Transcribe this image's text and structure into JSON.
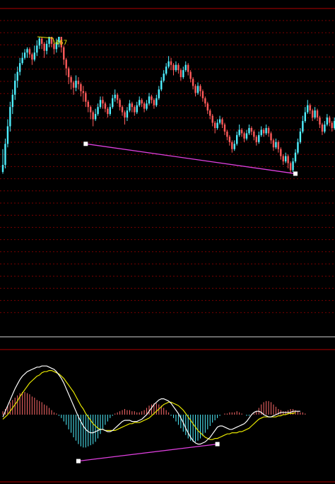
{
  "colors": {
    "background": "#000000",
    "grid": "#7a0000",
    "separator_red": "#b00000",
    "separator_gray": "#8c8c8c",
    "candle_up": "#ff5a5a",
    "candle_down": "#4ff0ff",
    "divergence_line": "#e040e0",
    "peak_marker": "#e6e600",
    "dif_line": "#ffffff",
    "dea_line": "#e6e600",
    "hist_positive": "#ff6a6a",
    "hist_negative": "#4ff0ff",
    "marker": "#ffffff"
  },
  "price_panel": {
    "peak_label": "467"
  },
  "chart_data": [
    {
      "type": "candlestick",
      "title": "",
      "ylim": [
        0,
        100
      ],
      "grid": true,
      "grid_style": "dotted horizontal",
      "candles": [
        [
          27,
          36,
          22,
          23
        ],
        [
          39,
          42,
          25,
          27
        ],
        [
          49,
          53,
          37,
          39
        ],
        [
          60,
          63,
          46,
          49
        ],
        [
          67,
          70,
          56,
          60
        ],
        [
          75,
          79,
          64,
          67
        ],
        [
          80,
          83,
          71,
          75
        ],
        [
          85,
          88,
          78,
          80
        ],
        [
          88,
          91,
          84,
          85
        ],
        [
          91,
          93,
          87,
          88
        ],
        [
          93,
          94,
          88,
          91
        ],
        [
          90,
          94,
          88,
          93
        ],
        [
          87,
          91,
          84,
          90
        ],
        [
          91,
          95,
          86,
          87
        ],
        [
          95,
          98,
          89,
          91
        ],
        [
          99,
          100,
          93,
          95
        ],
        [
          96,
          100,
          93,
          99
        ],
        [
          92,
          97,
          88,
          96
        ],
        [
          96,
          98,
          90,
          92
        ],
        [
          100,
          100,
          94,
          96
        ],
        [
          96,
          100,
          94,
          100
        ],
        [
          93,
          98,
          90,
          96
        ],
        [
          97,
          99,
          91,
          93
        ],
        [
          100,
          100,
          94,
          97
        ],
        [
          94,
          100,
          91,
          100
        ],
        [
          87,
          95,
          84,
          94
        ],
        [
          82,
          88,
          78,
          87
        ],
        [
          77,
          83,
          73,
          82
        ],
        [
          74,
          78,
          70,
          77
        ],
        [
          71,
          75,
          67,
          74
        ],
        [
          75,
          78,
          69,
          71
        ],
        [
          73,
          77,
          70,
          75
        ],
        [
          69,
          74,
          66,
          73
        ],
        [
          68,
          72,
          63,
          69
        ],
        [
          63,
          69,
          60,
          68
        ],
        [
          60,
          64,
          57,
          63
        ],
        [
          57,
          61,
          53,
          60
        ],
        [
          53,
          58,
          49,
          57
        ],
        [
          56,
          59,
          52,
          53
        ],
        [
          60,
          62,
          55,
          56
        ],
        [
          64,
          66,
          59,
          60
        ],
        [
          62,
          66,
          59,
          64
        ],
        [
          59,
          63,
          57,
          62
        ],
        [
          56,
          60,
          54,
          59
        ],
        [
          60,
          62,
          55,
          56
        ],
        [
          65,
          67,
          59,
          60
        ],
        [
          67,
          70,
          63,
          65
        ],
        [
          64,
          68,
          62,
          67
        ],
        [
          60,
          65,
          58,
          64
        ],
        [
          57,
          61,
          55,
          60
        ],
        [
          54,
          58,
          50,
          57
        ],
        [
          58,
          60,
          52,
          54
        ],
        [
          62,
          64,
          57,
          58
        ],
        [
          60,
          63,
          57,
          62
        ],
        [
          57,
          61,
          55,
          60
        ],
        [
          61,
          63,
          56,
          57
        ],
        [
          64,
          66,
          60,
          61
        ],
        [
          62,
          65,
          60,
          64
        ],
        [
          59,
          63,
          57,
          62
        ],
        [
          62,
          64,
          58,
          59
        ],
        [
          66,
          68,
          61,
          62
        ],
        [
          64,
          67,
          62,
          66
        ],
        [
          61,
          65,
          59,
          64
        ],
        [
          65,
          67,
          60,
          61
        ],
        [
          70,
          72,
          64,
          65
        ],
        [
          75,
          77,
          69,
          70
        ],
        [
          79,
          81,
          74,
          75
        ],
        [
          83,
          85,
          78,
          79
        ],
        [
          86,
          89,
          82,
          83
        ],
        [
          84,
          88,
          81,
          86
        ],
        [
          81,
          85,
          78,
          84
        ],
        [
          84,
          86,
          80,
          81
        ],
        [
          81,
          85,
          79,
          84
        ],
        [
          77,
          82,
          75,
          81
        ],
        [
          81,
          83,
          76,
          77
        ],
        [
          84,
          86,
          80,
          81
        ],
        [
          80,
          85,
          78,
          84
        ],
        [
          76,
          81,
          74,
          80
        ],
        [
          72,
          77,
          70,
          76
        ],
        [
          68,
          73,
          66,
          72
        ],
        [
          72,
          74,
          67,
          68
        ],
        [
          69,
          73,
          66,
          72
        ],
        [
          65,
          70,
          63,
          69
        ],
        [
          62,
          66,
          60,
          65
        ],
        [
          58,
          63,
          56,
          62
        ],
        [
          55,
          59,
          53,
          58
        ],
        [
          51,
          56,
          49,
          55
        ],
        [
          48,
          52,
          45,
          51
        ],
        [
          51,
          53,
          47,
          48
        ],
        [
          53,
          55,
          50,
          51
        ],
        [
          50,
          54,
          48,
          53
        ],
        [
          46,
          51,
          44,
          50
        ],
        [
          43,
          47,
          41,
          46
        ],
        [
          40,
          44,
          38,
          43
        ],
        [
          36,
          41,
          34,
          40
        ],
        [
          39,
          41,
          35,
          36
        ],
        [
          44,
          46,
          38,
          39
        ],
        [
          47,
          50,
          43,
          44
        ],
        [
          45,
          48,
          43,
          47
        ],
        [
          42,
          46,
          40,
          45
        ],
        [
          45,
          47,
          41,
          42
        ],
        [
          48,
          50,
          44,
          45
        ],
        [
          46,
          49,
          44,
          48
        ],
        [
          43,
          47,
          41,
          46
        ],
        [
          40,
          44,
          38,
          43
        ],
        [
          44,
          46,
          39,
          40
        ],
        [
          47,
          49,
          43,
          44
        ],
        [
          45,
          48,
          43,
          47
        ],
        [
          48,
          50,
          44,
          45
        ],
        [
          45,
          49,
          43,
          48
        ],
        [
          41,
          46,
          39,
          45
        ],
        [
          37,
          42,
          35,
          41
        ],
        [
          40,
          42,
          36,
          37
        ],
        [
          36,
          41,
          34,
          40
        ],
        [
          32,
          37,
          30,
          36
        ],
        [
          29,
          33,
          27,
          32
        ],
        [
          32,
          34,
          28,
          29
        ],
        [
          28,
          33,
          25,
          32
        ],
        [
          24,
          29,
          22,
          28
        ],
        [
          29,
          31,
          23,
          24
        ],
        [
          34,
          36,
          28,
          29
        ],
        [
          40,
          42,
          33,
          34
        ],
        [
          46,
          48,
          39,
          40
        ],
        [
          52,
          55,
          45,
          46
        ],
        [
          57,
          60,
          51,
          52
        ],
        [
          61,
          64,
          56,
          57
        ],
        [
          58,
          62,
          56,
          61
        ],
        [
          54,
          59,
          52,
          58
        ],
        [
          58,
          60,
          53,
          54
        ],
        [
          54,
          59,
          52,
          58
        ],
        [
          50,
          55,
          48,
          54
        ],
        [
          46,
          51,
          44,
          50
        ],
        [
          50,
          52,
          45,
          46
        ],
        [
          54,
          56,
          49,
          50
        ],
        [
          51,
          55,
          49,
          54
        ],
        [
          48,
          52,
          46,
          51
        ],
        [
          52,
          54,
          47,
          48
        ]
      ],
      "divergence_lines": [
        {
          "from": [
            34,
            39
          ],
          "to": [
            120,
            22
          ]
        }
      ],
      "markers": [
        {
          "index": 34,
          "value": 39
        },
        {
          "index": 120,
          "value": 22
        }
      ],
      "peak_marker": {
        "index": 20,
        "value": 100
      }
    },
    {
      "type": "macd",
      "title": "",
      "ylim": [
        -45,
        45
      ],
      "grid": false,
      "dif": [
        -2,
        3,
        8,
        13,
        18,
        23,
        27,
        31,
        34,
        36,
        38,
        39,
        40,
        41,
        42,
        42,
        43,
        43,
        43,
        42,
        41,
        40,
        38,
        35,
        32,
        28,
        23,
        18,
        13,
        8,
        3,
        -2,
        -6,
        -10,
        -13,
        -15,
        -16,
        -16,
        -15,
        -14,
        -13,
        -13,
        -14,
        -15,
        -15,
        -14,
        -12,
        -10,
        -8,
        -6,
        -5,
        -5,
        -5,
        -6,
        -6,
        -6,
        -5,
        -4,
        -2,
        0,
        3,
        6,
        9,
        11,
        13,
        14,
        14,
        13,
        12,
        10,
        7,
        4,
        1,
        -3,
        -7,
        -12,
        -16,
        -20,
        -23,
        -25,
        -26,
        -26,
        -25,
        -24,
        -22,
        -20,
        -17,
        -14,
        -11,
        -10,
        -10,
        -11,
        -12,
        -13,
        -13,
        -12,
        -11,
        -10,
        -9,
        -8,
        -6,
        -3,
        0,
        2,
        3,
        3,
        2,
        0,
        -1,
        -2,
        -2,
        -1,
        0,
        1,
        2,
        2,
        2,
        2,
        2,
        3,
        3,
        3,
        3
      ],
      "dea": [
        -4,
        -2,
        0,
        3,
        6,
        9,
        12,
        16,
        19,
        22,
        25,
        28,
        30,
        32,
        34,
        35,
        37,
        38,
        38,
        39,
        39,
        38,
        37,
        36,
        34,
        32,
        29,
        26,
        23,
        20,
        16,
        12,
        8,
        5,
        1,
        -2,
        -5,
        -8,
        -10,
        -12,
        -13,
        -13,
        -14,
        -14,
        -14,
        -14,
        -14,
        -13,
        -12,
        -11,
        -10,
        -9,
        -8,
        -8,
        -7,
        -7,
        -7,
        -6,
        -5,
        -4,
        -3,
        -1,
        1,
        3,
        5,
        7,
        9,
        10,
        11,
        11,
        10,
        9,
        8,
        6,
        4,
        1,
        -2,
        -5,
        -8,
        -11,
        -14,
        -16,
        -18,
        -20,
        -21,
        -22,
        -22,
        -21,
        -21,
        -20,
        -19,
        -18,
        -17,
        -17,
        -16,
        -16,
        -16,
        -15,
        -15,
        -14,
        -13,
        -12,
        -10,
        -8,
        -6,
        -4,
        -3,
        -2,
        -2,
        -2,
        -2,
        -2,
        -2,
        -1,
        -1,
        0,
        0,
        1,
        1,
        1,
        2
      ],
      "histogram": [
        3,
        5,
        8,
        11,
        13,
        15,
        17,
        19,
        20,
        20,
        19,
        18,
        16,
        15,
        13,
        12,
        11,
        9,
        8,
        6,
        4,
        2,
        1,
        -1,
        -3,
        -6,
        -9,
        -13,
        -16,
        -20,
        -23,
        -26,
        -28,
        -29,
        -29,
        -28,
        -27,
        -26,
        -24,
        -21,
        -17,
        -13,
        -9,
        -6,
        -3,
        -1,
        1,
        2,
        3,
        4,
        5,
        4,
        4,
        3,
        3,
        2,
        2,
        3,
        4,
        6,
        8,
        9,
        10,
        10,
        9,
        8,
        6,
        4,
        2,
        -1,
        -3,
        -6,
        -9,
        -12,
        -15,
        -18,
        -21,
        -23,
        -24,
        -24,
        -23,
        -21,
        -19,
        -16,
        -13,
        -10,
        -7,
        -5,
        -3,
        -1,
        0,
        1,
        1,
        2,
        2,
        2,
        3,
        2,
        1,
        0,
        -1,
        -1,
        0,
        1,
        3,
        6,
        9,
        11,
        12,
        12,
        11,
        9,
        7,
        5,
        4,
        3,
        3,
        4,
        5,
        5,
        4,
        3,
        2,
        2,
        1
      ],
      "divergence_lines": [
        {
          "from": [
            31,
            -41
          ],
          "to": [
            88,
            -26
          ]
        }
      ],
      "markers": [
        {
          "index": 31,
          "value": -41
        },
        {
          "index": 88,
          "value": -26
        }
      ]
    }
  ]
}
